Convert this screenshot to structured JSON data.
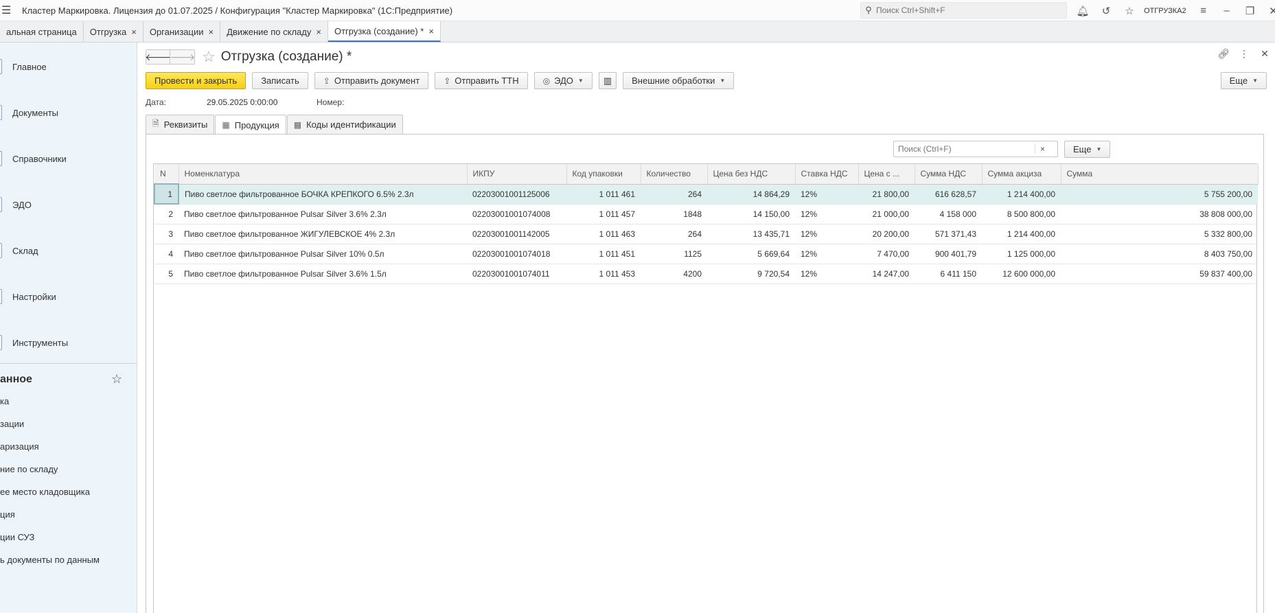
{
  "titlebar": {
    "menu_icon": "hamburger-icon",
    "title": "Кластер Маркировка. Лицензия до 01.07.2025 / Конфигурация \"Кластер Маркировка\"  (1С:Предприятие)",
    "search_placeholder": "Поиск Ctrl+Shift+F",
    "user": "ОТГРУЗКА2"
  },
  "tabs": [
    {
      "label": "альная страница",
      "closable": false
    },
    {
      "label": "Отгрузка",
      "closable": true
    },
    {
      "label": "Организации",
      "closable": true
    },
    {
      "label": "Движение по складу",
      "closable": true
    },
    {
      "label": "Отгрузка (создание) *",
      "closable": true,
      "active": true
    }
  ],
  "sidebar": {
    "sections": [
      {
        "label": "Главное"
      },
      {
        "label": "Документы"
      },
      {
        "label": "Справочники"
      },
      {
        "label": "ЭДО"
      },
      {
        "label": "Склад"
      },
      {
        "label": "Настройки"
      },
      {
        "label": "Инструменты"
      }
    ],
    "favorites_title": "анное",
    "favorites": [
      {
        "label": "ка"
      },
      {
        "label": "зации"
      },
      {
        "label": "аризация"
      },
      {
        "label": "ние по складу"
      },
      {
        "label": "ее место кладовщика"
      },
      {
        "label": "ция"
      },
      {
        "label": "ции СУЗ"
      },
      {
        "label": "ь документы по данным"
      }
    ]
  },
  "form": {
    "title": "Отгрузка (создание) *",
    "toolbar": {
      "post_close": "Провести и закрыть",
      "save": "Записать",
      "send_doc": "Отправить документ",
      "send_ttn": "Отправить ТТН",
      "edo": "ЭДО",
      "external": "Внешние обработки",
      "more": "Еще"
    },
    "date_label": "Дата:",
    "date_value": "29.05.2025 0:00:00",
    "number_label": "Номер:",
    "number_value": "",
    "tabs": [
      {
        "label": "Реквизиты",
        "icon": "document-icon"
      },
      {
        "label": "Продукция",
        "icon": "table-icon",
        "active": true
      },
      {
        "label": "Коды идентификации",
        "icon": "qr-code-icon"
      }
    ],
    "search_placeholder": "Поиск (Ctrl+F)",
    "search_clear": "×",
    "more": "Еще"
  },
  "table": {
    "columns": [
      "N",
      "Номенклатура",
      "ИКПУ",
      "Код упаковки",
      "Количество",
      "Цена без НДС",
      "Ставка НДС",
      "Цена с ...",
      "Сумма НДС",
      "Сумма акциза",
      "Сумма"
    ],
    "rows": [
      [
        "1",
        "Пиво светлое фильтрованное БОЧКА КРЕПКОГО  6.5% 2.3л",
        "02203001001125006",
        "1 011 461",
        "264",
        "14 864,29",
        "12%",
        "21 800,00",
        "616 628,57",
        "1 214 400,00",
        "5 755 200,00"
      ],
      [
        "2",
        "Пиво светлое фильтрованное Pulsar Silver 3.6% 2.3л",
        "02203001001074008",
        "1 011 457",
        "1848",
        "14 150,00",
        "12%",
        "21 000,00",
        "4 158 000",
        "8 500 800,00",
        "38 808 000,00"
      ],
      [
        "3",
        "Пиво светлое фильтрованное ЖИГУЛЕВСКОЕ 4% 2.3л",
        "02203001001142005",
        "1 011 463",
        "264",
        "13 435,71",
        "12%",
        "20 200,00",
        "571 371,43",
        "1 214 400,00",
        "5 332 800,00"
      ],
      [
        "4",
        "Пиво светлое фильтрованное Pulsar Silver 10% 0.5л",
        "02203001001074018",
        "1 011 451",
        "1125",
        "5 669,64",
        "12%",
        "7 470,00",
        "900 401,79",
        "1 125 000,00",
        "8 403 750,00"
      ],
      [
        "5",
        "Пиво светлое фильтрованное Pulsar Silver 3.6% 1.5л",
        "02203001001074011",
        "1 011 453",
        "4200",
        "9 720,54",
        "12%",
        "14 247,00",
        "6 411 150",
        "12 600 000,00",
        "59 837 400,00"
      ]
    ]
  }
}
